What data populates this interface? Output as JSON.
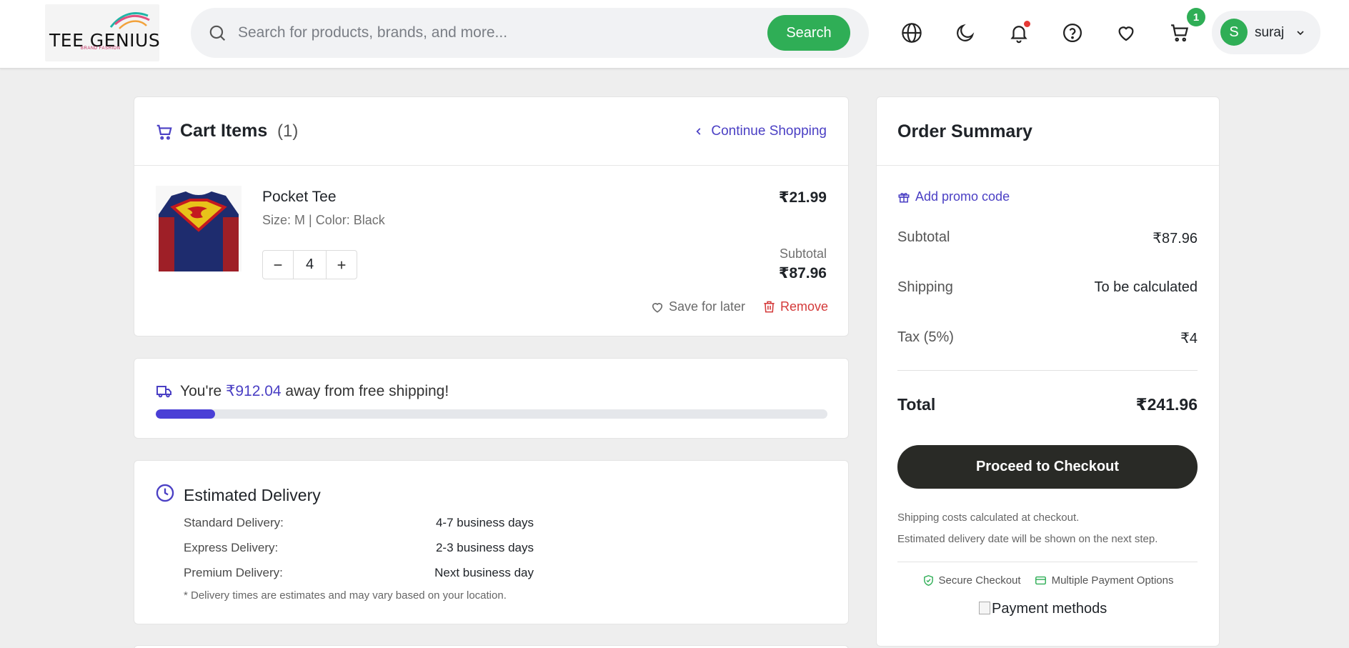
{
  "header": {
    "logo_text": "TEE GENIUS",
    "logo_sub": "BRAND FASHION",
    "search_placeholder": "Search for products, brands, and more...",
    "search_button": "Search",
    "cart_count": "1",
    "user_initial": "S",
    "user_name": "suraj"
  },
  "cart": {
    "title": "Cart Items",
    "count": "(1)",
    "continue_label": "Continue Shopping",
    "item": {
      "name": "Pocket Tee",
      "variant": "Size: M | Color: Black",
      "price": "₹21.99",
      "quantity": "4",
      "subtotal_label": "Subtotal",
      "subtotal_value": "₹87.96",
      "save_label": "Save for later",
      "remove_label": "Remove"
    }
  },
  "shipping": {
    "prefix": "You're",
    "amount": "₹912.04",
    "suffix": "away from free shipping!",
    "progress_percent": 8.8
  },
  "delivery": {
    "title": "Estimated Delivery",
    "rows": [
      {
        "label": "Standard Delivery:",
        "value": "4-7 business days"
      },
      {
        "label": "Express Delivery:",
        "value": "2-3 business days"
      },
      {
        "label": "Premium Delivery:",
        "value": "Next business day"
      }
    ],
    "note": "* Delivery times are estimates and may vary based on your location."
  },
  "summary": {
    "title": "Order Summary",
    "promo_label": "Add promo code",
    "rows": [
      {
        "label": "Subtotal",
        "value": "₹87.96"
      },
      {
        "label": "Shipping",
        "value": "To be calculated"
      },
      {
        "label": "Tax (5%)",
        "value": "₹4"
      }
    ],
    "total_label": "Total",
    "total_value": "₹241.96",
    "checkout_label": "Proceed to Checkout",
    "note1": "Shipping costs calculated at checkout.",
    "note2": "Estimated delivery date will be shown on the next step.",
    "badge_secure": "Secure Checkout",
    "badge_payment": "Multiple Payment Options",
    "payment_alt": "Payment methods"
  },
  "colors": {
    "accent": "#4a3fc4",
    "brand_green": "#2fae56",
    "danger": "#d43a3a",
    "checkout_bg": "#292a26"
  }
}
